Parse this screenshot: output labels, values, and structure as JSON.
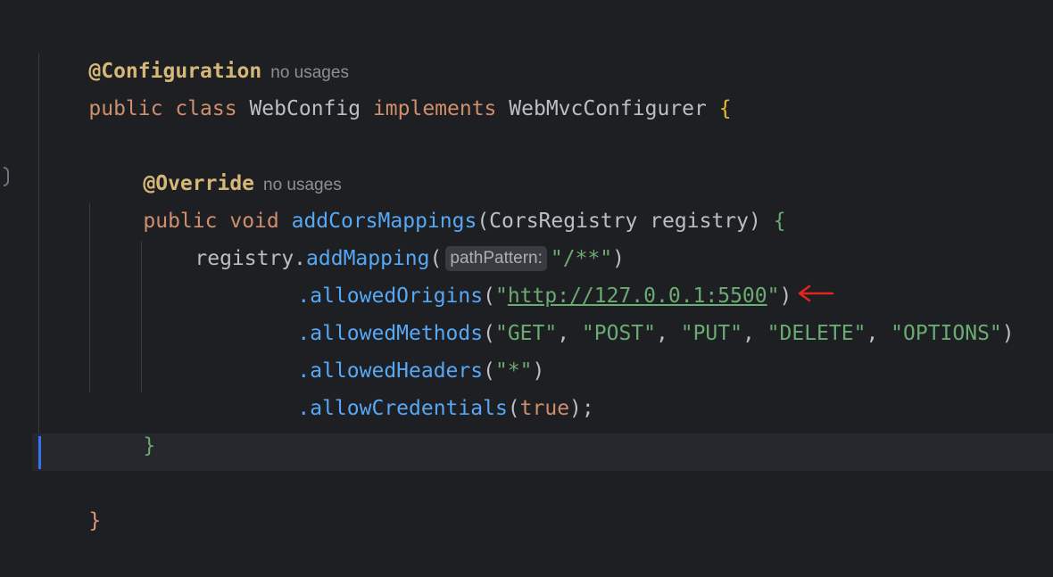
{
  "code": {
    "line1": {
      "annotation": "@Configuration",
      "usages": "no usages"
    },
    "line2": {
      "kw_public": "public",
      "kw_class": "class",
      "class_name": "WebConfig",
      "kw_implements": "implements",
      "iface": "WebMvcConfigurer",
      "brace": "{"
    },
    "line4": {
      "annotation": "@Override",
      "usages": "no usages"
    },
    "line5": {
      "kw_public": "public",
      "kw_void": "void",
      "method": "addCorsMappings",
      "open": "(",
      "param_type": "CorsRegistry",
      "param_name": "registry",
      "close": ")",
      "brace": "{"
    },
    "line6": {
      "receiver": "registry",
      "dot": ".",
      "method": "addMapping",
      "open": "(",
      "hint": "pathPattern:",
      "arg": "\"/**\"",
      "close": ")"
    },
    "line7": {
      "method": ".allowedOrigins",
      "open": "(",
      "q1": "\"",
      "url": "http://127.0.0.1:5500",
      "q2": "\"",
      "close": ")"
    },
    "line8": {
      "method": ".allowedMethods",
      "open": "(",
      "args": [
        "\"GET\"",
        "\"POST\"",
        "\"PUT\"",
        "\"DELETE\"",
        "\"OPTIONS\""
      ],
      "sep": ", ",
      "close": ")"
    },
    "line9": {
      "method": ".allowedHeaders",
      "open": "(",
      "arg": "\"*\"",
      "close": ")"
    },
    "line10": {
      "method": ".allowCredentials",
      "open": "(",
      "arg": "true",
      "close": ")",
      "semi": ";"
    },
    "line11": {
      "brace": "}"
    },
    "line13": {
      "brace": "}"
    }
  },
  "colors": {
    "background": "#1e1f22",
    "keyword": "#cf8e6d",
    "function": "#56a8f5",
    "string": "#6aab73",
    "annotation": "#b3ae60",
    "caret": "#3574f0",
    "arrow": "#e0271e"
  }
}
